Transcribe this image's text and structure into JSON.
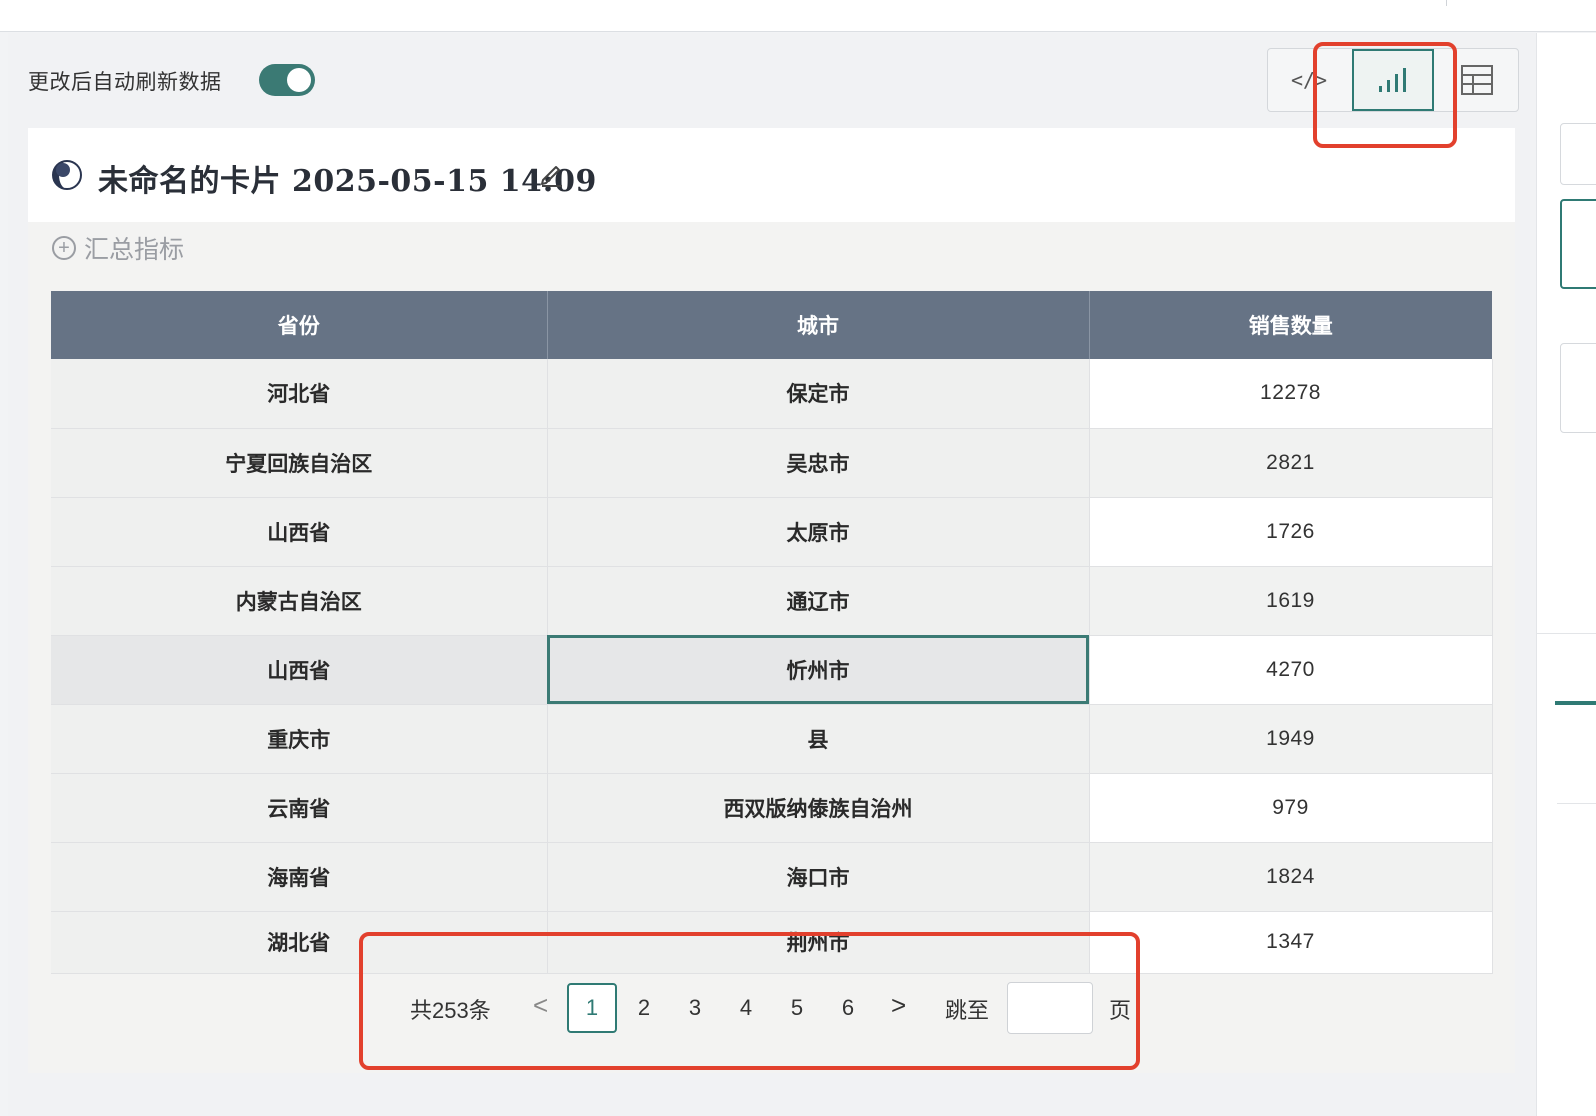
{
  "toolbar": {
    "auto_refresh_label": "更改后自动刷新数据",
    "auto_refresh_on": true,
    "view_buttons": [
      {
        "name": "code-view",
        "label": "</>"
      },
      {
        "name": "chart-view",
        "label": ""
      },
      {
        "name": "table-view",
        "label": ""
      }
    ],
    "active_view": "chart-view"
  },
  "card": {
    "title": "未命名的卡片 2025-05-15 14:09",
    "add_metric_label": "汇总指标"
  },
  "table": {
    "columns": [
      "省份",
      "城市",
      "销售数量"
    ],
    "rows": [
      [
        "河北省",
        "保定市",
        "12278"
      ],
      [
        "宁夏回族自治区",
        "吴忠市",
        "2821"
      ],
      [
        "山西省",
        "太原市",
        "1726"
      ],
      [
        "内蒙古自治区",
        "通辽市",
        "1619"
      ],
      [
        "山西省",
        "忻州市",
        "4270"
      ],
      [
        "重庆市",
        "县",
        "1949"
      ],
      [
        "云南省",
        "西双版纳傣族自治州",
        "979"
      ],
      [
        "海南省",
        "海口市",
        "1824"
      ],
      [
        "湖北省",
        "荆州市",
        "1347"
      ]
    ],
    "selected_cell": {
      "row": 4,
      "col": 1
    }
  },
  "pager": {
    "total_label": "共253条",
    "prev": "<",
    "next": ">",
    "pages": [
      "1",
      "2",
      "3",
      "4",
      "5",
      "6"
    ],
    "current": "1",
    "goto_label": "跳至",
    "goto_value": "",
    "page_suffix": "页"
  },
  "colors": {
    "accent": "#2f7a74",
    "header_bg": "#667385",
    "highlight": "#e2402d"
  }
}
